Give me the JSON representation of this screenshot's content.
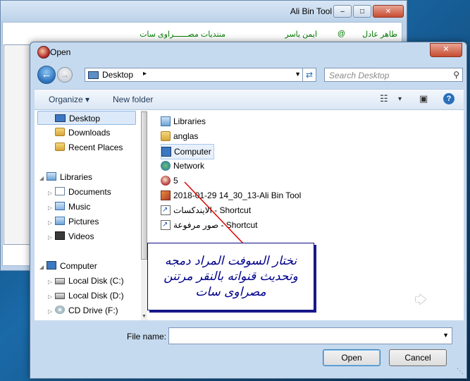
{
  "background_window": {
    "title": "Ali Bin Tool",
    "minimize": "–",
    "maximize": "□",
    "close": "✕",
    "header_row": {
      "item1": "طاهر عادل",
      "item2": "@",
      "item3": "ايمن ياسر",
      "item4": "منتديات مصــــــراوى سات"
    }
  },
  "dialog": {
    "title": "Open",
    "close": "✕",
    "address": {
      "location": "Desktop",
      "separator": "▸",
      "dropdown": "▼"
    },
    "search_placeholder": "Search Desktop",
    "toolbar": {
      "organize": "Organize ▾",
      "new_folder": "New folder",
      "view_icon": "☷",
      "view_dropdown": "▾",
      "preview_icon": "▣",
      "help_icon": "?"
    },
    "nav_pane": {
      "favorites": [
        "Desktop",
        "Downloads",
        "Recent Places"
      ],
      "libraries_label": "Libraries",
      "libraries": [
        "Documents",
        "Music",
        "Pictures",
        "Videos"
      ],
      "computer_label": "Computer",
      "computer": [
        "Local Disk (C:)",
        "Local Disk (D:)",
        "CD Drive (F:)"
      ]
    },
    "files": [
      {
        "name": "Libraries",
        "icon": "library-icon"
      },
      {
        "name": "anglas",
        "icon": "folder-icon"
      },
      {
        "name": "Computer",
        "icon": "computer-icon"
      },
      {
        "name": "Network",
        "icon": "network-icon"
      },
      {
        "name": "5",
        "icon": "app-icon"
      },
      {
        "name": "2018-01-29 14_30_13-Ali Bin Tool",
        "icon": "image-icon"
      },
      {
        "name": "الايندكسات - Shortcut",
        "icon": "shortcut-icon"
      },
      {
        "name": "صور مرفوعة - Shortcut",
        "icon": "shortcut-icon"
      }
    ],
    "file_name_label": "File name:",
    "file_name_value": "",
    "open_button": "Open",
    "cancel_button": "Cancel"
  },
  "callout": {
    "line1": "نختار السوفت المراد دمجه",
    "line2": "وتحديث قنواته بالنقر مرتنن",
    "line3": "مصراوى سات"
  },
  "colors": {
    "callout_text": "#00008b",
    "arrow": "#e00000"
  }
}
